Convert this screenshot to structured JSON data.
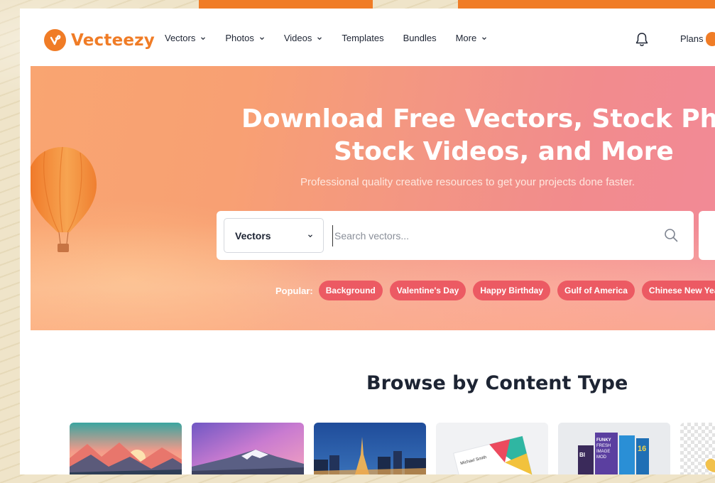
{
  "brand": {
    "name": "Vecteezy",
    "accent": "#f07c26"
  },
  "nav": {
    "items": [
      {
        "label": "Vectors",
        "has_dropdown": true
      },
      {
        "label": "Photos",
        "has_dropdown": true
      },
      {
        "label": "Videos",
        "has_dropdown": true
      },
      {
        "label": "Templates",
        "has_dropdown": false
      },
      {
        "label": "Bundles",
        "has_dropdown": false
      },
      {
        "label": "More",
        "has_dropdown": true
      }
    ],
    "notifications_icon": "bell-icon",
    "plans_label": "Plans"
  },
  "hero": {
    "title_line1": "Download Free Vectors, Stock Photos,",
    "title_line2": "Stock Videos, and More",
    "subtitle": "Professional quality creative resources to get your projects done faster.",
    "search": {
      "category": "Vectors",
      "placeholder": "Search vectors...",
      "search_icon": "search-icon"
    },
    "popular": {
      "label": "Popular:",
      "tags": [
        "Background",
        "Valentine's Day",
        "Happy Birthday",
        "Gulf of America",
        "Chinese New Year"
      ],
      "chip_color": "#ec5a63"
    }
  },
  "browse": {
    "title": "Browse by Content Type",
    "thumbnails": [
      {
        "name": "mountains-sunset"
      },
      {
        "name": "snowy-peak"
      },
      {
        "name": "city-night-tower"
      },
      {
        "name": "business-card"
      },
      {
        "name": "product-boxes"
      },
      {
        "name": "transparent-png"
      }
    ],
    "business_card_name": "Michael Smith",
    "box_texts": [
      "FUNKY",
      "FRESH",
      "IMAGE",
      "MOD",
      "16"
    ]
  }
}
